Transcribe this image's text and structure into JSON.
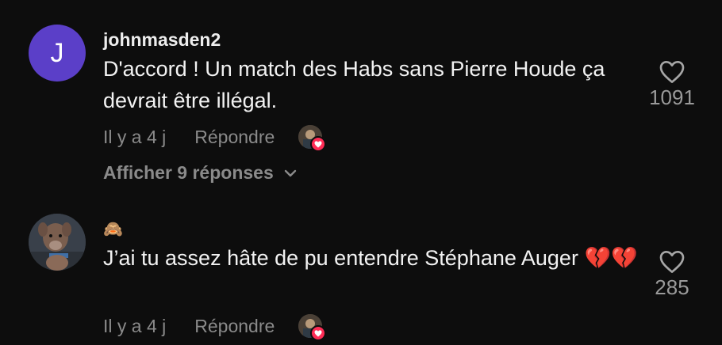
{
  "comments": [
    {
      "username": "johnmasden2",
      "avatar_letter": "J",
      "text": "D'accord ! Un match des Habs sans Pierre Houde ça devrait être illégal.",
      "time": "Il y a 4 j",
      "reply_label": "Répondre",
      "like_count": "1091",
      "view_replies_label": "Afficher 9 réponses"
    },
    {
      "username_emoji": "🙈",
      "text": "J’ai tu assez hâte de pu entendre Stéphane Auger 💔💔",
      "time": "Il y a 4 j",
      "reply_label": "Répondre",
      "like_count": "285"
    }
  ],
  "colors": {
    "background": "#0d0d0d",
    "avatar_purple": "#5b3fc8",
    "muted_text": "#8a8a8a",
    "heart_badge": "#fe2c55"
  },
  "icons": [
    "heart-outline-icon",
    "chevron-down-icon",
    "creator-liked-heart-icon"
  ]
}
